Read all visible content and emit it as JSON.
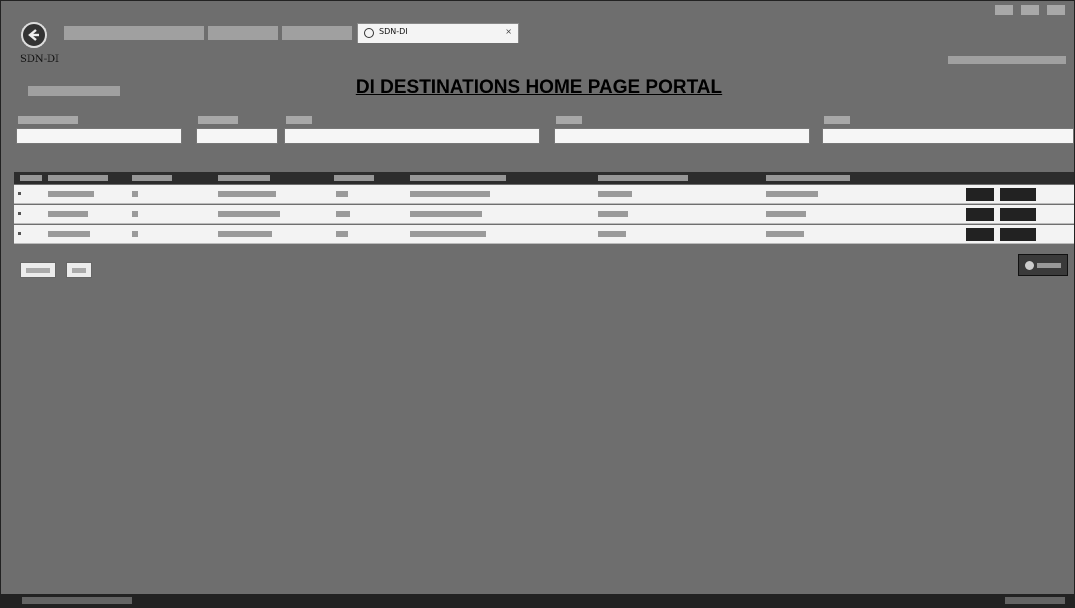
{
  "browser": {
    "tabs": [
      {
        "label": ""
      },
      {
        "label": ""
      },
      {
        "label": "SDN-DI"
      }
    ],
    "window_controls": [
      "minimize",
      "maximize",
      "close"
    ]
  },
  "page": {
    "app_label": "SDN-DI",
    "top_right_links": ""
  },
  "main": {
    "back_link": "",
    "heading": "DI DESTINATIONS HOME PAGE PORTAL",
    "filters": [
      {
        "label": "",
        "value": ""
      },
      {
        "label": "",
        "value": ""
      },
      {
        "label": "",
        "value": ""
      },
      {
        "label": "",
        "value": ""
      },
      {
        "label": "",
        "value": ""
      }
    ]
  },
  "table": {
    "columns": [
      "",
      "",
      "",
      "",
      "",
      "",
      "",
      ""
    ],
    "rows": [
      {
        "cells": [
          "",
          "",
          "",
          "",
          "",
          "",
          ""
        ]
      },
      {
        "cells": [
          "",
          "",
          "",
          "",
          "",
          "",
          ""
        ]
      },
      {
        "cells": [
          "",
          "",
          "",
          "",
          "",
          "",
          ""
        ]
      }
    ],
    "row_actions": [
      "edit",
      "delete"
    ]
  },
  "buttons": {
    "previous": "",
    "next": "",
    "add": ""
  },
  "status_bar": {
    "text": "",
    "zoom": ""
  },
  "colors": {
    "header": "#2c2c2c",
    "row_bg": "#f3f3f3",
    "heading_text": "#000000"
  },
  "icons": [
    "back-arrow-icon",
    "tab-globe-icon",
    "tab-close-icon",
    "add-icon"
  ]
}
